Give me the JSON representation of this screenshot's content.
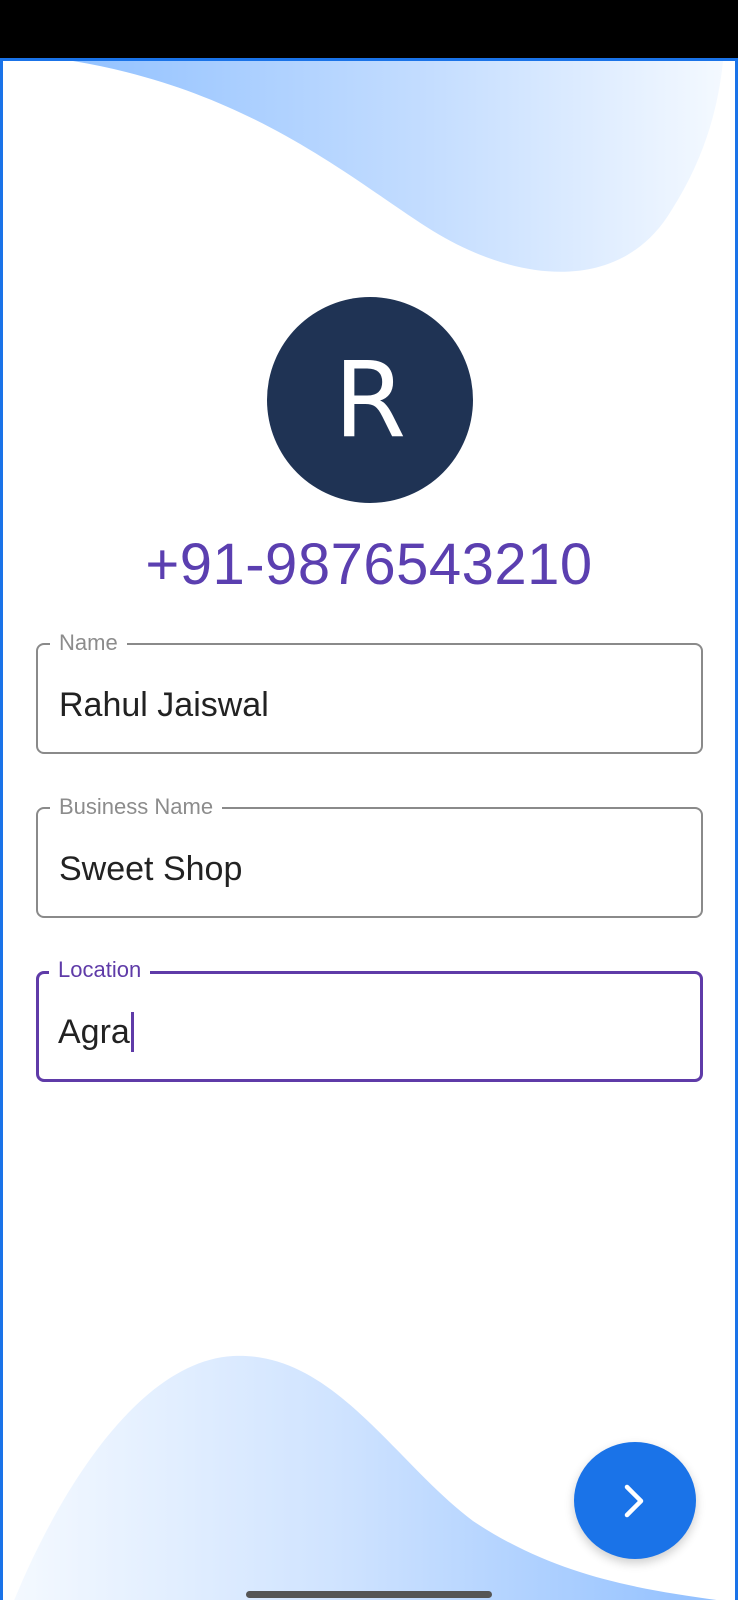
{
  "colors": {
    "accent": "#1a73e8",
    "primary_text": "#5b3fb0",
    "avatar_bg": "#1f3354",
    "wave_light": "#eaf3ff",
    "wave_dark": "#93c2ff"
  },
  "profile": {
    "avatar_initial": "R",
    "phone": "+91-9876543210"
  },
  "form": {
    "name": {
      "label": "Name",
      "value": "Rahul Jaiswal"
    },
    "business_name": {
      "label": "Business Name",
      "value": "Sweet Shop"
    },
    "location": {
      "label": "Location",
      "value": "Agra",
      "focused": true
    }
  },
  "actions": {
    "next_icon": "chevron-right-icon"
  }
}
